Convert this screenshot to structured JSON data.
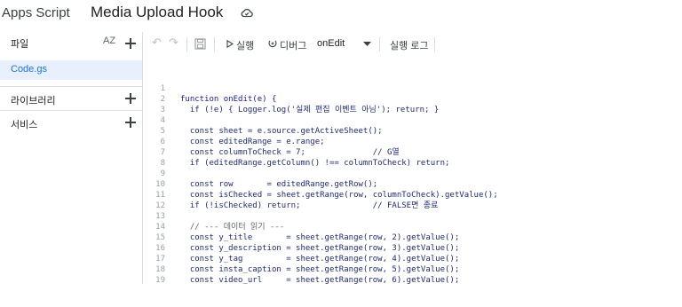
{
  "header": {
    "app_name": "Apps Script",
    "project_title": "Media Upload Hook"
  },
  "sidebar": {
    "files_label": "파일",
    "sort_label": "AZ",
    "files": [
      {
        "name": "Code.gs",
        "selected": true
      }
    ],
    "libraries_label": "라이브러리",
    "services_label": "서비스"
  },
  "toolbar": {
    "run_label": "실행",
    "debug_label": "디버그",
    "function_select": "onEdit",
    "log_label": "실행 로그"
  },
  "editor": {
    "lines": [
      {
        "n": "1",
        "text": "function onEdit(e) {"
      },
      {
        "n": "2",
        "text": "  if (!e) { Logger.log('실제 편집 이벤트 아님'); return; }"
      },
      {
        "n": "3",
        "text": ""
      },
      {
        "n": "4",
        "text": "  const sheet = e.source.getActiveSheet();"
      },
      {
        "n": "5",
        "text": "  const editedRange = e.range;"
      },
      {
        "n": "6",
        "text": "  const columnToCheck = 7;              // G열"
      },
      {
        "n": "7",
        "text": "  if (editedRange.getColumn() !== columnToCheck) return;"
      },
      {
        "n": "8",
        "text": ""
      },
      {
        "n": "9",
        "text": "  const row       = editedRange.getRow();"
      },
      {
        "n": "10",
        "text": "  const isChecked = sheet.getRange(row, columnToCheck).getValue();"
      },
      {
        "n": "11",
        "text": "  if (!isChecked) return;               // FALSE면 종료"
      },
      {
        "n": "12",
        "text": ""
      },
      {
        "n": "13",
        "text": "  // --- 데이터 읽기 ---"
      },
      {
        "n": "14",
        "text": "  const y_title       = sheet.getRange(row, 2).getValue();"
      },
      {
        "n": "15",
        "text": "  const y_description = sheet.getRange(row, 3).getValue();"
      },
      {
        "n": "16",
        "text": "  const y_tag         = sheet.getRange(row, 4).getValue();"
      },
      {
        "n": "17",
        "text": "  const insta_caption = sheet.getRange(row, 5).getValue();"
      },
      {
        "n": "18",
        "text": "  const video_url     = sheet.getRange(row, 6).getValue();"
      },
      {
        "n": "19",
        "text": ""
      }
    ]
  },
  "colors": {
    "accent": "#1a73e8",
    "selected_bg": "#e8f0fe",
    "keyword": "#1a1aa6",
    "string": "#c5221f"
  }
}
